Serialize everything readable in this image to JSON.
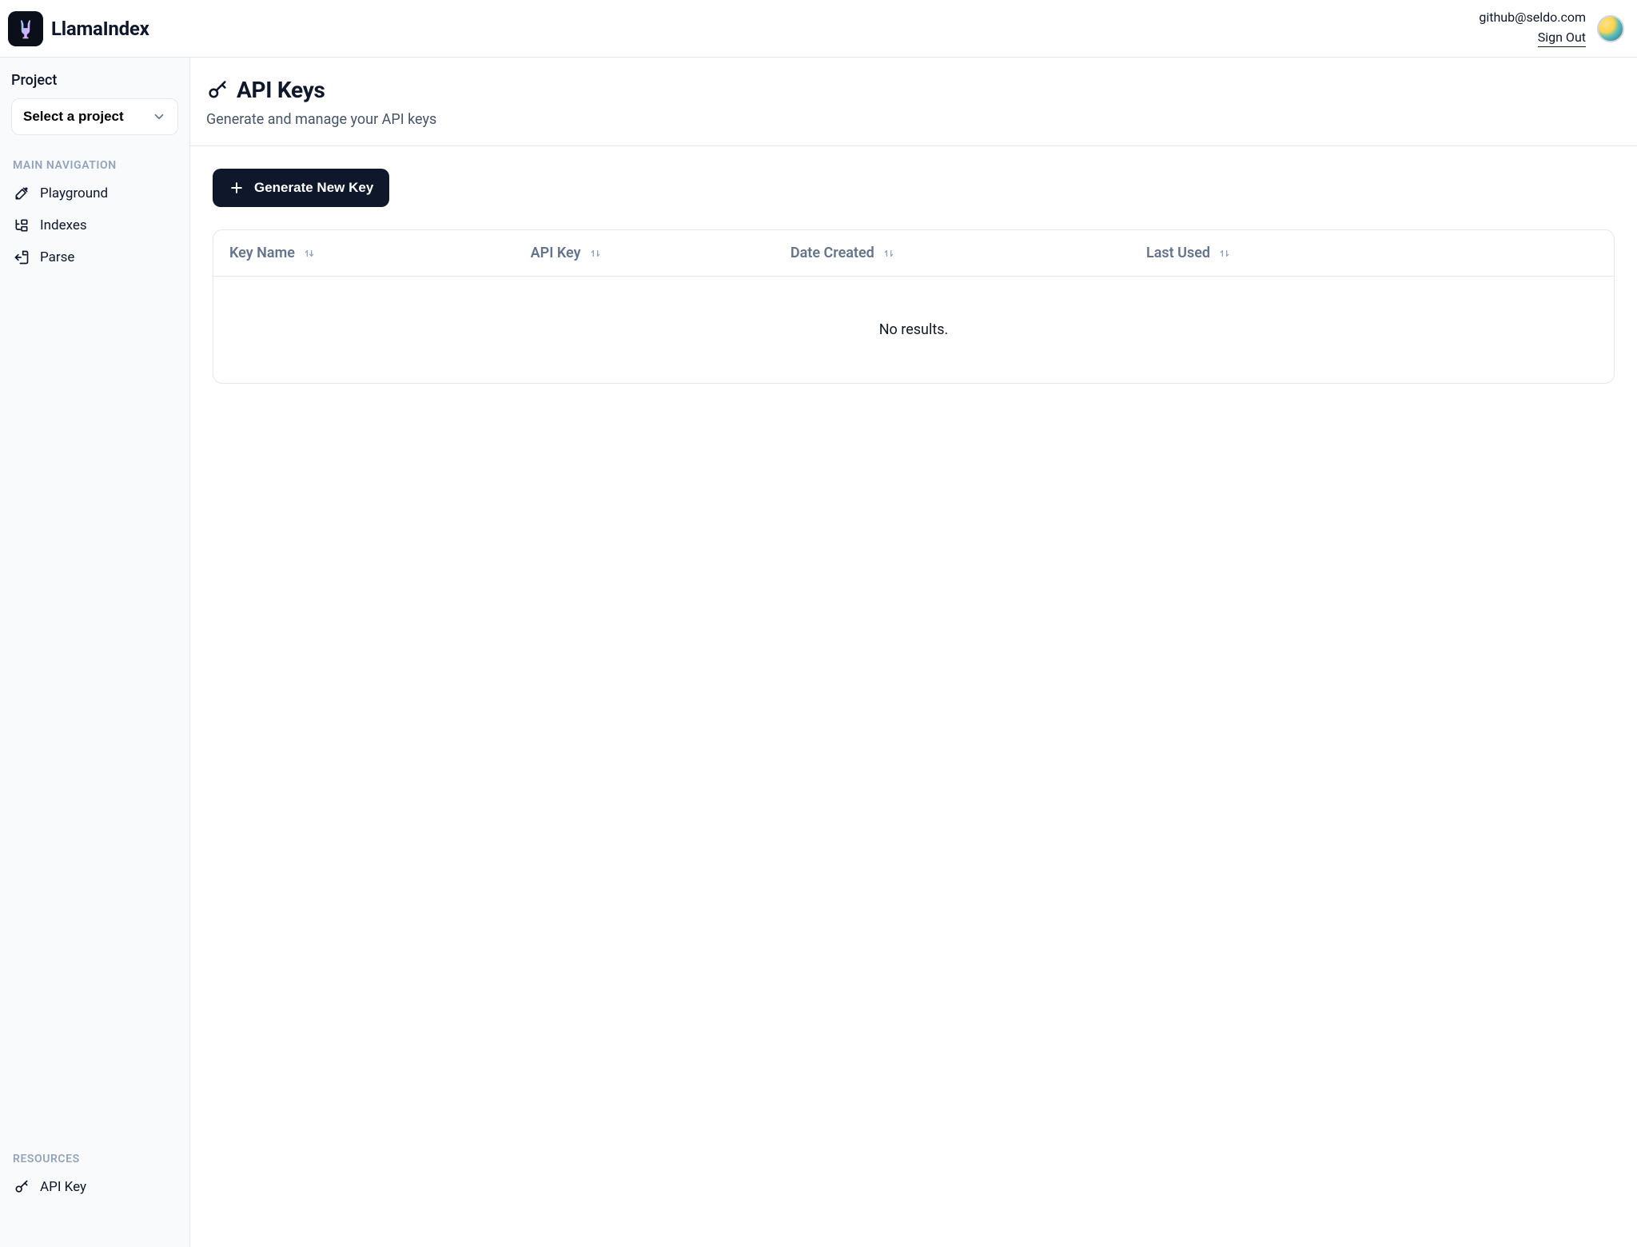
{
  "brand": {
    "name": "LlamaIndex"
  },
  "header": {
    "user_email": "github@seldo.com",
    "sign_out_label": "Sign Out"
  },
  "sidebar": {
    "project_label": "Project",
    "project_select_label": "Select a project",
    "main_nav_heading": "MAIN NAVIGATION",
    "nav_items": [
      {
        "label": "Playground"
      },
      {
        "label": "Indexes"
      },
      {
        "label": "Parse"
      }
    ],
    "resources_heading": "RESOURCES",
    "resources_items": [
      {
        "label": "API Key"
      }
    ]
  },
  "page": {
    "title": "API Keys",
    "subtitle": "Generate and manage your API keys",
    "generate_button_label": "Generate New Key"
  },
  "table": {
    "columns": {
      "key_name": "Key Name",
      "api_key": "API Key",
      "date_created": "Date Created",
      "last_used": "Last Used"
    },
    "rows": [],
    "empty_message": "No results."
  }
}
